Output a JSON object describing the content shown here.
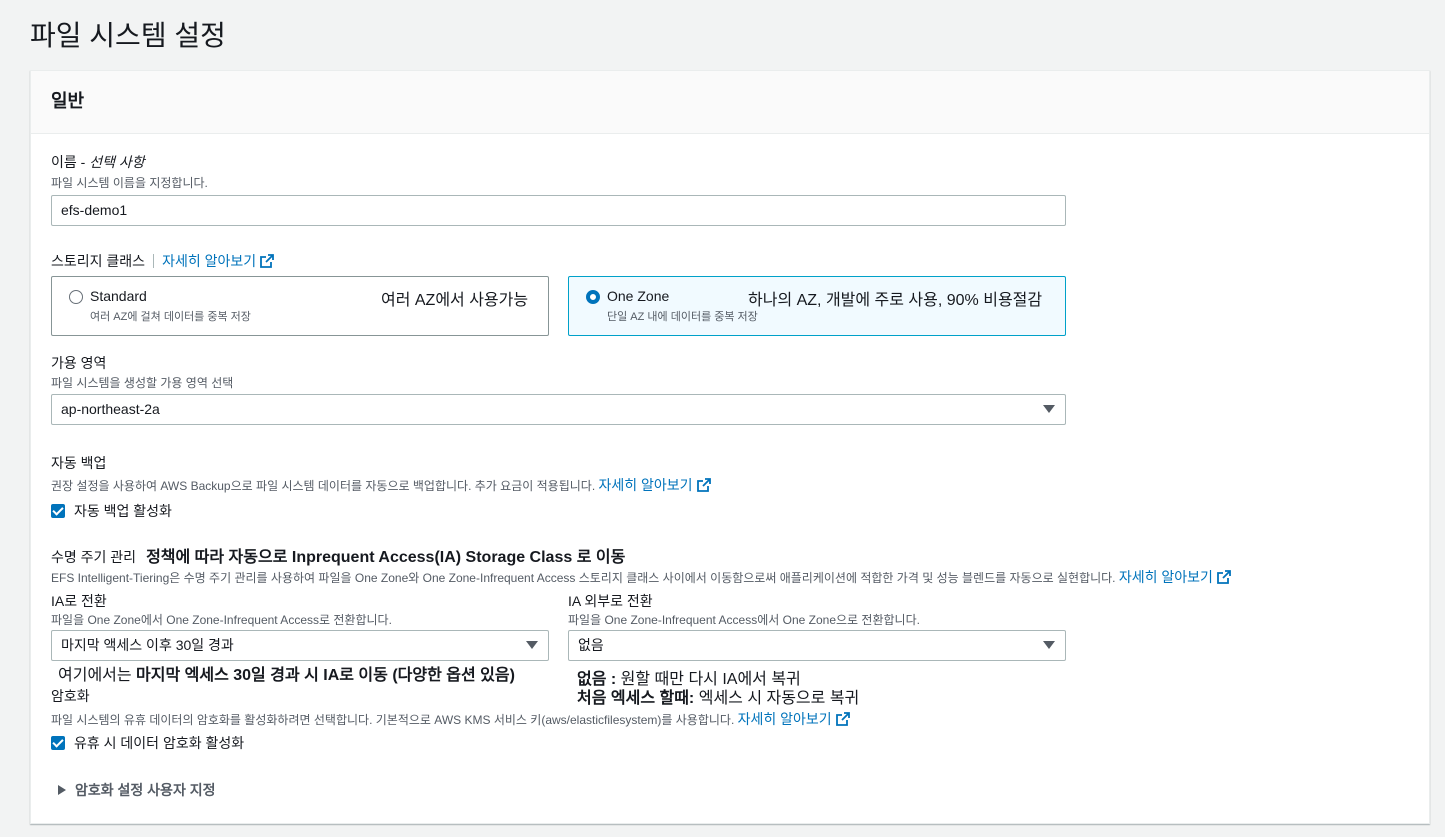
{
  "page_title": "파일 시스템 설정",
  "panel": {
    "title": "일반"
  },
  "name_field": {
    "label": "이름 - ",
    "label_optional": "선택 사항",
    "description": "파일 시스템 이름을 지정합니다.",
    "value": "efs-demo1"
  },
  "storage_class": {
    "label": "스토리지 클래스",
    "learn_more": "자세히 알아보기",
    "options": [
      {
        "title": "Standard",
        "description": "여러 AZ에 걸쳐 데이터를 중복 저장",
        "note": "여러 AZ에서 사용가능",
        "selected": false
      },
      {
        "title": "One Zone",
        "description": "단일 AZ 내에 데이터를 중복 저장",
        "note": "하나의 AZ, 개발에 주로 사용, 90% 비용절감",
        "selected": true
      }
    ]
  },
  "availability_zone": {
    "label": "가용 영역",
    "description": "파일 시스템을 생성할 가용 영역 선택",
    "value": "ap-northeast-2a"
  },
  "backup": {
    "label": "자동 백업",
    "description": "권장 설정을 사용하여 AWS Backup으로 파일 시스템 데이터를 자동으로 백업합니다. 추가 요금이 적용됩니다.",
    "learn_more": "자세히 알아보기",
    "checkbox_label": "자동 백업 활성화",
    "checked": true
  },
  "lifecycle": {
    "label": "수명 주기 관리",
    "annotation": "정책에 따라 자동으로 Inprequent Access(IA) Storage Class 로 이동",
    "description": "EFS Intelligent-Tiering은 수명 주기 관리를 사용하여 파일을 One Zone와 One Zone-Infrequent Access 스토리지 클래스 사이에서 이동함으로써 애플리케이션에 적합한 가격 및 성능 블렌드를 자동으로 실현합니다.",
    "learn_more": "자세히 알아보기",
    "to_ia": {
      "label": "IA로 전환",
      "description": "파일을 One Zone에서 One Zone-Infrequent Access로 전환합니다.",
      "value": "마지막 액세스 이후 30일 경과",
      "note_prefix": "여기에서는 ",
      "note_bold": "마지막 엑세스 30일 경과 시 IA로 이동 (다양한 옵션 있음)"
    },
    "out_of_ia": {
      "label": "IA 외부로 전환",
      "description": "파일을 One Zone-Infrequent Access에서 One Zone으로 전환합니다.",
      "value": "없음",
      "note1_bold": "없음 : ",
      "note1_text": "원할 때만 다시 IA에서 복귀",
      "note2_bold": "처음 엑세스 할때: ",
      "note2_text": "엑세스 시 자동으로 복귀"
    }
  },
  "encryption": {
    "label": "암호화",
    "description": "파일 시스템의 유휴 데이터의 암호화를 활성화하려면 선택합니다. 기본적으로 AWS KMS 서비스 키(aws/elasticfilesystem)를 사용합니다.",
    "learn_more": "자세히 알아보기",
    "checkbox_label": "유휴 시 데이터 암호화 활성화",
    "checked": true,
    "custom_settings_label": "암호화 설정 사용자 지정"
  }
}
